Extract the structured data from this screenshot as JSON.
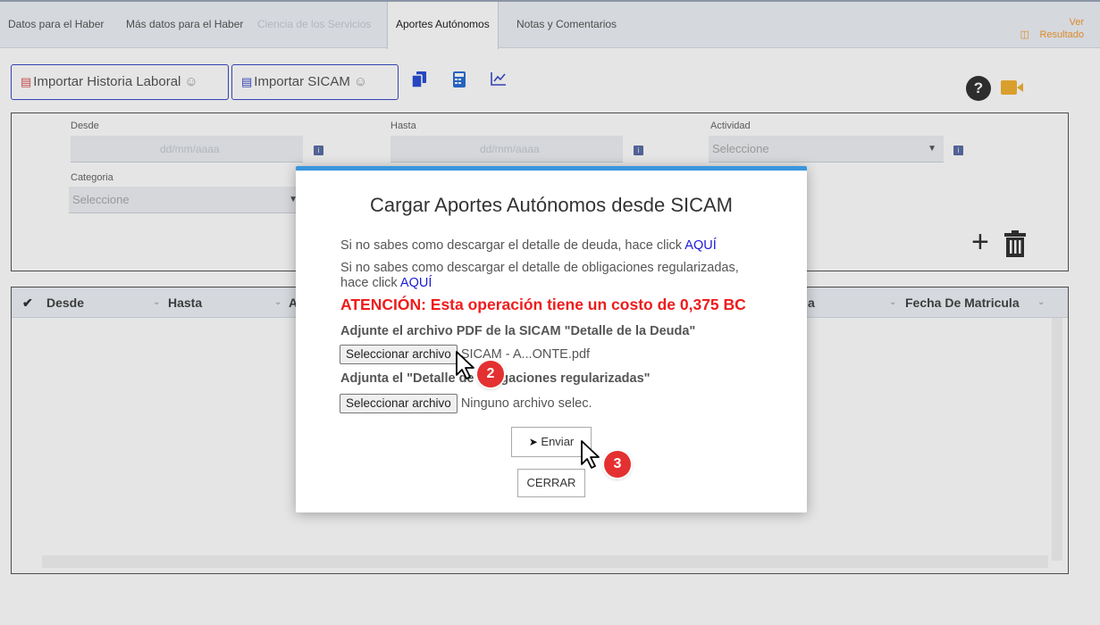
{
  "tabs": [
    {
      "label": "Datos para el Haber"
    },
    {
      "label": "Más datos para el Haber"
    },
    {
      "label": "Ciencia de los Servicios"
    },
    {
      "label": "Aportes Autónomos"
    },
    {
      "label": "Notas y Comentarios"
    }
  ],
  "ver_resultado": "Ver Resultado",
  "toolbar": {
    "import_history": "Importar Historia Laboral",
    "import_sicam": "Importar SICAM",
    "icons": [
      "copy-icon",
      "calculator-icon",
      "chart-line-icon",
      "help-icon",
      "video-icon"
    ]
  },
  "form": {
    "desde_label": "Desde",
    "desde_placeholder": "dd/mm/aaaa",
    "hasta_label": "Hasta",
    "hasta_placeholder": "dd/mm/aaaa",
    "actividad_label": "Actividad",
    "actividad_value": "Seleccione",
    "categoria_label": "Categoria",
    "categoria_value": "Seleccione"
  },
  "grid": {
    "headers": [
      "Desde",
      "Hasta",
      "A",
      "a",
      "Fecha De Matricula"
    ]
  },
  "modal": {
    "title": "Cargar Aportes Autónomos desde SICAM",
    "line1_text": "Si no sabes como descargar el detalle de deuda, hace click ",
    "line1_link": "AQUÍ",
    "line2_text": "Si no sabes como descargar el detalle de obligaciones regularizadas,",
    "line2b_text": "hace click ",
    "line2_link": "AQUÍ",
    "warning": "ATENCIÓN: Esta operación tiene un costo de 0,375 BC",
    "attach_pdf_label": "Adjunte el archivo PDF de la SICAM \"Detalle de la Deuda\"",
    "file1_button": "Seleccionar archivo",
    "file1_name": "SICAM - A...ONTE.pdf",
    "attach2_label": "Adjunta el \"Detalle de obligaciones regularizadas\"",
    "file2_button": "Seleccionar archivo",
    "file2_name": "Ninguno archivo selec.",
    "send_button": "Enviar",
    "close_button": "CERRAR"
  },
  "steps": [
    "2",
    "3"
  ],
  "colors": {
    "accent": "#3b4bc8",
    "modal_top": "#3a96dc",
    "warning": "#ee1c1c",
    "link": "#1a1ad8",
    "badge": "#e43030",
    "result": "#f39c32"
  }
}
